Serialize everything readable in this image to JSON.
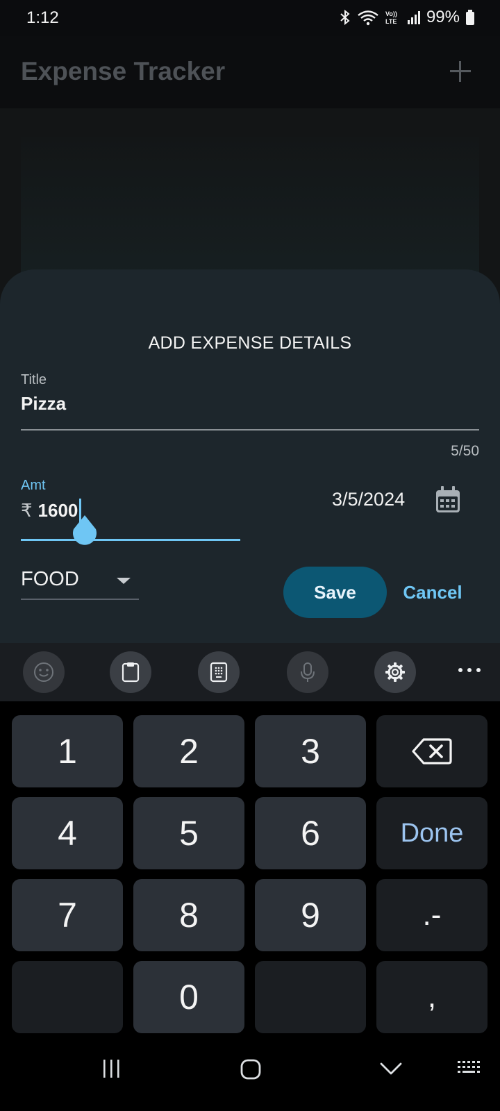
{
  "status_bar": {
    "time": "1:12",
    "battery": "99%",
    "icons": [
      "bluetooth-icon",
      "wifi-icon",
      "volte-icon",
      "signal-icon",
      "battery-icon"
    ]
  },
  "app_bar": {
    "title": "Expense Tracker",
    "action_icon": "plus-icon"
  },
  "sheet": {
    "heading": "ADD EXPENSE DETAILS",
    "title_field": {
      "label": "Title",
      "value": "Pizza",
      "counter": "5/50"
    },
    "amount_field": {
      "label": "Amt",
      "currency": "₹",
      "value": "1600"
    },
    "date": {
      "value": "3/5/2024",
      "icon": "calendar-icon"
    },
    "category": {
      "value": "FOOD",
      "icon": "dropdown-arrow-icon"
    },
    "save_label": "Save",
    "cancel_label": "Cancel"
  },
  "keyboard": {
    "toolbar_icons": [
      "emoji-icon",
      "clipboard-icon",
      "keypad-icon",
      "microphone-icon",
      "settings-icon",
      "more-icon"
    ],
    "keys": {
      "k1": "1",
      "k2": "2",
      "k3": "3",
      "k4": "4",
      "k5": "5",
      "k6": "6",
      "done": "Done",
      "k7": "7",
      "k8": "8",
      "k9": "9",
      "dot_dash": ".-",
      "k0": "0",
      "comma": ","
    },
    "backspace_icon": "backspace-icon"
  },
  "nav_bar": {
    "icons": [
      "recent-apps-icon",
      "home-icon",
      "back-icon",
      "keyboard-switch-icon"
    ]
  },
  "colors": {
    "accent": "#6fc6f4",
    "save_button": "#0c5773",
    "sheet_background": "#1d262c",
    "done_text": "#9cc4ef"
  }
}
